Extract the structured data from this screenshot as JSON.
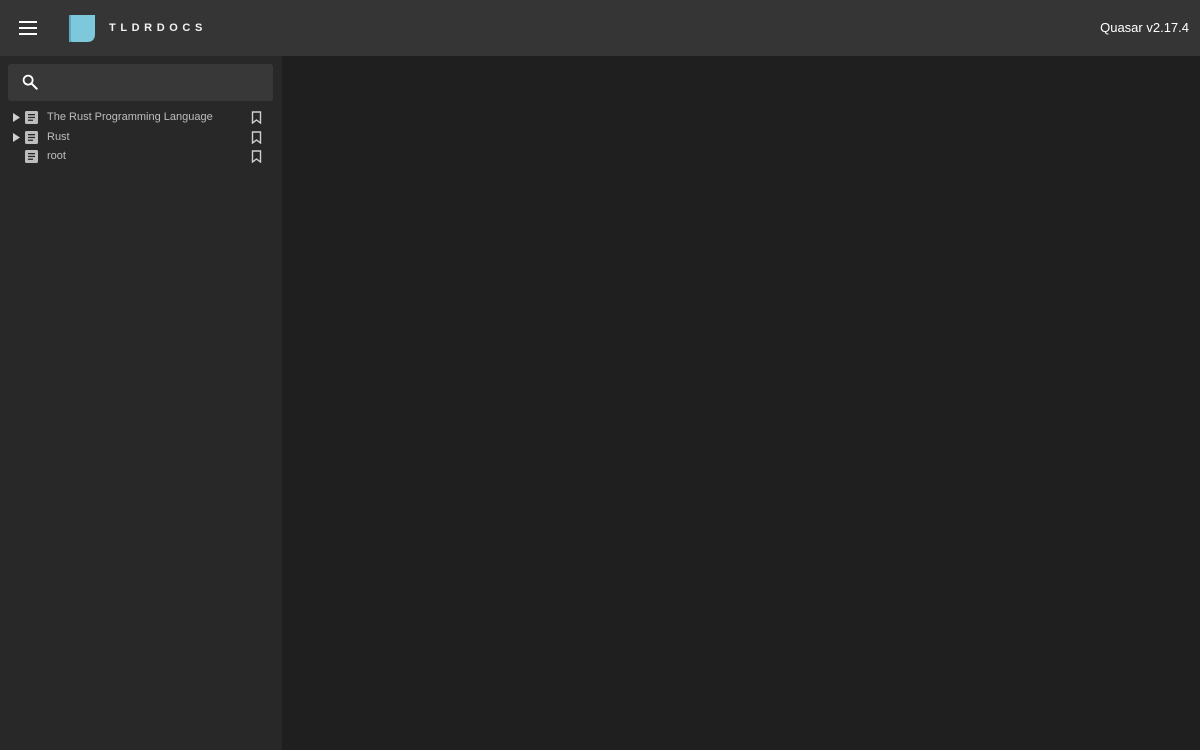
{
  "header": {
    "brand": "TLDRDOCS",
    "version": "Quasar v2.17.4",
    "menu_icon": "hamburger-menu-icon",
    "logo_color": "#7ec8dc"
  },
  "search": {
    "icon": "search-icon",
    "value": "",
    "placeholder": ""
  },
  "tree": {
    "items": [
      {
        "label": "The Rust Programming Language",
        "expandable": true,
        "icon": "document-icon",
        "action_icon": "bookmark-icon"
      },
      {
        "label": "Rust",
        "expandable": true,
        "icon": "document-icon",
        "action_icon": "bookmark-icon"
      },
      {
        "label": "root",
        "expandable": false,
        "icon": "document-icon",
        "action_icon": "bookmark-icon"
      }
    ]
  },
  "colors": {
    "header_bg": "#353535",
    "sidebar_bg": "#282828",
    "main_bg": "#1f1f1f",
    "search_bg": "#383838",
    "accent": "#7ec8dc"
  }
}
